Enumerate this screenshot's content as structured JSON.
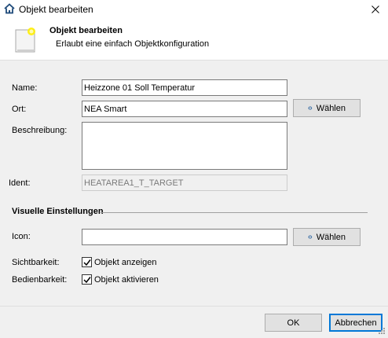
{
  "window": {
    "title": "Objekt bearbeiten"
  },
  "header": {
    "title": "Objekt bearbeiten",
    "subtitle": "Erlaubt eine einfach Objektkonfiguration"
  },
  "form": {
    "name": {
      "label": "Name:",
      "value": "Heizzone 01 Soll Temperatur"
    },
    "ort": {
      "label": "Ort:",
      "value": "NEA Smart",
      "button": "Wählen"
    },
    "beschreibung": {
      "label": "Beschreibung:",
      "value": ""
    },
    "ident": {
      "label": "Ident:",
      "value": "HEATAREA1_T_TARGET"
    }
  },
  "visual": {
    "section_title": "Visuelle Einstellungen",
    "icon": {
      "label": "Icon:",
      "value": "",
      "button": "Wählen"
    },
    "visibility": {
      "label": "Sichtbarkeit:",
      "checkbox": "Objekt anzeigen",
      "checked": true
    },
    "operability": {
      "label": "Bedienbarkeit:",
      "checkbox": "Objekt aktivieren",
      "checked": true
    }
  },
  "footer": {
    "ok": "OK",
    "cancel": "Abbrechen"
  },
  "colors": {
    "accent": "#0078d7",
    "icon_blue": "#3a6ea5",
    "note_yellow": "#ffee00"
  }
}
